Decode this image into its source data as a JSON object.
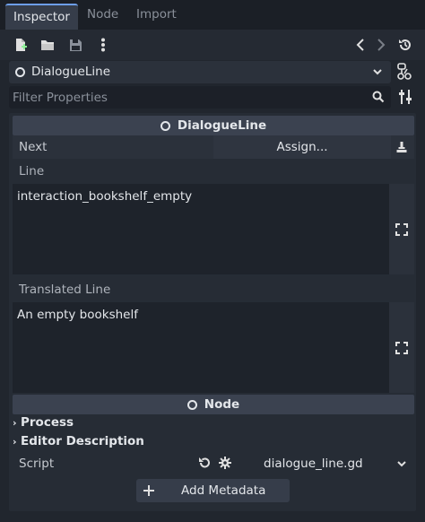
{
  "tabs": [
    {
      "label": "Inspector",
      "active": true
    },
    {
      "label": "Node",
      "active": false
    },
    {
      "label": "Import",
      "active": false
    }
  ],
  "toolbar": {
    "icons": [
      "new-resource-icon",
      "open-folder-icon",
      "save-icon",
      "kebab-menu-icon",
      "history-back-icon",
      "history-forward-icon",
      "history-list-icon"
    ]
  },
  "object_selector": {
    "name": "DialogueLine"
  },
  "filter": {
    "placeholder": "Filter Properties"
  },
  "sections": {
    "dialogue_line": {
      "title": "DialogueLine",
      "next_label": "Next",
      "next_value": "Assign...",
      "line_label": "Line",
      "line_value": "interaction_bookshelf_empty",
      "translated_label": "Translated Line",
      "translated_value": "An empty bookshelf"
    },
    "node": {
      "title": "Node",
      "categories": [
        "Process",
        "Editor Description"
      ],
      "script_label": "Script",
      "script_value": "dialogue_line.gd"
    }
  },
  "add_metadata_label": "Add Metadata",
  "colors": {
    "accent": "#6d9ee8",
    "panel_bg": "#262c35",
    "section_header": "#3b4250",
    "new_icon_green": "#8eef97"
  }
}
